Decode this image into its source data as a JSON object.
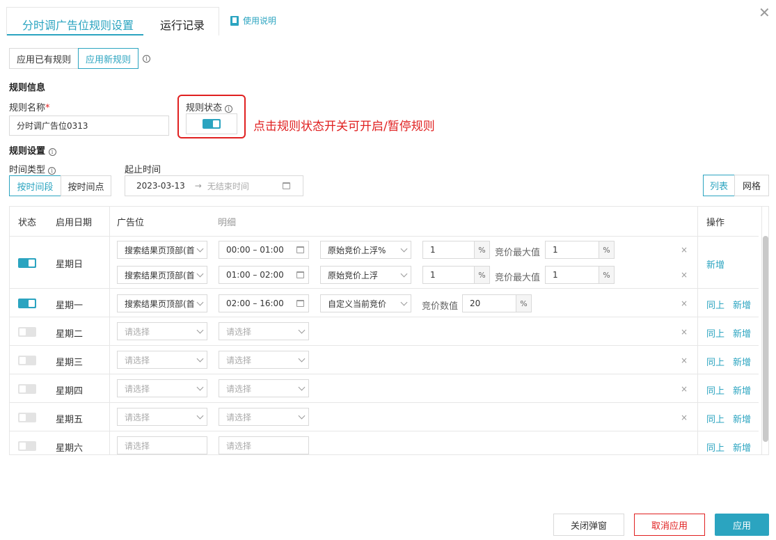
{
  "tabs": {
    "rules": "分时调广告位规则设置",
    "logs": "运行记录"
  },
  "help_label": "使用说明",
  "mode": {
    "existing": "应用已有规则",
    "new": "应用新规则"
  },
  "rule_info": {
    "section": "规则信息",
    "name_label": "规则名称",
    "required_mark": "*",
    "name_value": "分时调广告位0313",
    "status_label": "规则状态"
  },
  "annotation": "点击规则状态开关可开启/暂停规则",
  "rule_settings": {
    "section": "规则设置",
    "time_type_label": "时间类型",
    "time_type_period": "按时间段",
    "time_type_point": "按时间点",
    "range_label": "起止时间",
    "start_date": "2023-03-13",
    "arrow": "→",
    "end_placeholder": "无结束时间",
    "view_list": "列表",
    "view_grid": "网格"
  },
  "table": {
    "headers": {
      "status": "状态",
      "date": "启用日期",
      "slot": "广告位",
      "detail": "明细",
      "ops": "操作"
    },
    "slot_value": "搜索结果页顶部(首",
    "placeholder": "请选择",
    "percent": "%",
    "remove": "×",
    "max_label": "竞价最大值",
    "value_label": "竞价数值",
    "same_as_above": "同上",
    "add": "新增",
    "rows": [
      {
        "day": "星期日",
        "on": true,
        "lines": [
          {
            "time": "00:00 – 01:00",
            "mode": "原始竞价上浮%",
            "pct": "1",
            "max": "1"
          },
          {
            "time": "01:00 – 02:00",
            "mode": "原始竞价上浮",
            "pct": "1",
            "max": "1"
          }
        ]
      },
      {
        "day": "星期一",
        "on": true,
        "time": "02:00 – 16:00",
        "mode": "自定义当前竞价",
        "value": "20"
      },
      {
        "day": "星期二",
        "on": false
      },
      {
        "day": "星期三",
        "on": false
      },
      {
        "day": "星期四",
        "on": false
      },
      {
        "day": "星期五",
        "on": false
      },
      {
        "day": "星期六",
        "on": false
      }
    ]
  },
  "footer": {
    "close": "关闭弹窗",
    "cancel": "取消应用",
    "apply": "应用"
  },
  "colors": {
    "accent": "#2ba4c0",
    "danger": "#e02020",
    "border": "#d9d9d9"
  }
}
